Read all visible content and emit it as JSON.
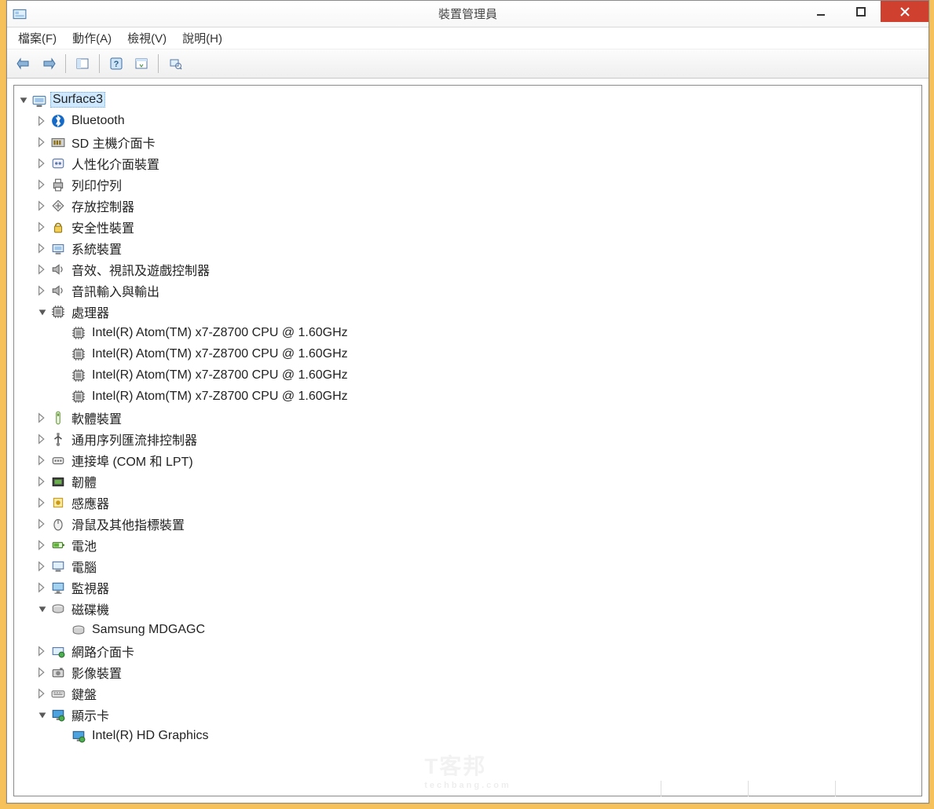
{
  "window": {
    "title": "裝置管理員"
  },
  "menu": {
    "file": "檔案(F)",
    "action": "動作(A)",
    "view": "檢視(V)",
    "help": "說明(H)"
  },
  "tree": {
    "root": "Surface3",
    "categories": [
      {
        "id": "bluetooth",
        "label": "Bluetooth",
        "icon": "bluetooth",
        "expanded": false
      },
      {
        "id": "sdhost",
        "label": "SD 主機介面卡",
        "icon": "card",
        "expanded": false
      },
      {
        "id": "hid",
        "label": "人性化介面裝置",
        "icon": "hid",
        "expanded": false
      },
      {
        "id": "printqueue",
        "label": "列印佇列",
        "icon": "printer",
        "expanded": false
      },
      {
        "id": "storagectl",
        "label": "存放控制器",
        "icon": "storage-ctl",
        "expanded": false
      },
      {
        "id": "security",
        "label": "安全性裝置",
        "icon": "security",
        "expanded": false
      },
      {
        "id": "system",
        "label": "系統裝置",
        "icon": "system",
        "expanded": false
      },
      {
        "id": "avgame",
        "label": "音效、視訊及遊戲控制器",
        "icon": "speaker",
        "expanded": false
      },
      {
        "id": "audioio",
        "label": "音訊輸入與輸出",
        "icon": "speaker",
        "expanded": false
      },
      {
        "id": "cpu",
        "label": "處理器",
        "icon": "cpu",
        "expanded": true,
        "children": [
          {
            "label": "Intel(R) Atom(TM) x7-Z8700  CPU @ 1.60GHz",
            "icon": "cpu"
          },
          {
            "label": "Intel(R) Atom(TM) x7-Z8700  CPU @ 1.60GHz",
            "icon": "cpu"
          },
          {
            "label": "Intel(R) Atom(TM) x7-Z8700  CPU @ 1.60GHz",
            "icon": "cpu"
          },
          {
            "label": "Intel(R) Atom(TM) x7-Z8700  CPU @ 1.60GHz",
            "icon": "cpu"
          }
        ]
      },
      {
        "id": "softdev",
        "label": "軟體裝置",
        "icon": "software",
        "expanded": false
      },
      {
        "id": "usb",
        "label": "通用序列匯流排控制器",
        "icon": "usb",
        "expanded": false
      },
      {
        "id": "ports",
        "label": "連接埠 (COM 和 LPT)",
        "icon": "port",
        "expanded": false
      },
      {
        "id": "firmware",
        "label": "韌體",
        "icon": "firmware",
        "expanded": false
      },
      {
        "id": "sensor",
        "label": "感應器",
        "icon": "sensor",
        "expanded": false
      },
      {
        "id": "mouse",
        "label": "滑鼠及其他指標裝置",
        "icon": "mouse",
        "expanded": false
      },
      {
        "id": "battery",
        "label": "電池",
        "icon": "battery",
        "expanded": false
      },
      {
        "id": "computer",
        "label": "電腦",
        "icon": "computer",
        "expanded": false
      },
      {
        "id": "monitor",
        "label": "監視器",
        "icon": "monitor",
        "expanded": false
      },
      {
        "id": "disk",
        "label": "磁碟機",
        "icon": "disk",
        "expanded": true,
        "children": [
          {
            "label": "Samsung MDGAGC",
            "icon": "disk"
          }
        ]
      },
      {
        "id": "network",
        "label": "網路介面卡",
        "icon": "network",
        "expanded": false
      },
      {
        "id": "imaging",
        "label": "影像裝置",
        "icon": "imaging",
        "expanded": false
      },
      {
        "id": "keyboard",
        "label": "鍵盤",
        "icon": "keyboard",
        "expanded": false
      },
      {
        "id": "display",
        "label": "顯示卡",
        "icon": "display",
        "expanded": true,
        "children": [
          {
            "label": "Intel(R) HD Graphics",
            "icon": "display"
          }
        ]
      }
    ]
  },
  "watermark": {
    "text": "T客邦",
    "sub": "techbang.com"
  }
}
